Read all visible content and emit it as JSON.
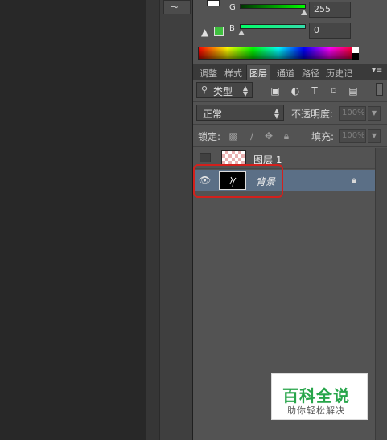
{
  "color_panel": {
    "g_label": "G",
    "g_value": "255",
    "b_label": "B",
    "b_value": "0",
    "gamut_warning_icon": "warning-triangle-icon",
    "colors": {
      "g_slider": "#00ff00",
      "b_slider": "#33dd55",
      "gamut_swatch": "#3fbf3f",
      "foreground_swatch": "#ffffff"
    }
  },
  "tabs": [
    {
      "label": "调整"
    },
    {
      "label": "样式"
    },
    {
      "label": "图层",
      "active": true
    },
    {
      "label": "通道"
    },
    {
      "label": "路径"
    },
    {
      "label": "历史记"
    }
  ],
  "layers_panel": {
    "filter": {
      "label": "类型",
      "icon": "search-icon"
    },
    "filter_icons": [
      "image-filter-icon",
      "adjustment-filter-icon",
      "type-filter-icon",
      "shape-filter-icon",
      "smart-object-filter-icon"
    ],
    "type_icon_glyph": "T",
    "blend_mode": "正常",
    "opacity_label": "不透明度:",
    "opacity_value": "100%",
    "lock_label": "锁定:",
    "lock_icons": [
      "lock-transparent-icon",
      "lock-paint-icon",
      "lock-move-icon",
      "lock-all-icon"
    ],
    "fill_label": "填充:",
    "fill_value": "100%",
    "layers": [
      {
        "name": "图层 1",
        "visible": false,
        "selected": false
      },
      {
        "name": "背景",
        "visible": true,
        "selected": true,
        "locked": true,
        "italic": true
      }
    ]
  },
  "watermark": {
    "title": "百科全说",
    "subtitle": "助你轻松解决",
    "color": "#27a54a"
  },
  "ui_colors": {
    "highlight_box": "#d3201c",
    "selected_layer": "#5b6f86"
  }
}
